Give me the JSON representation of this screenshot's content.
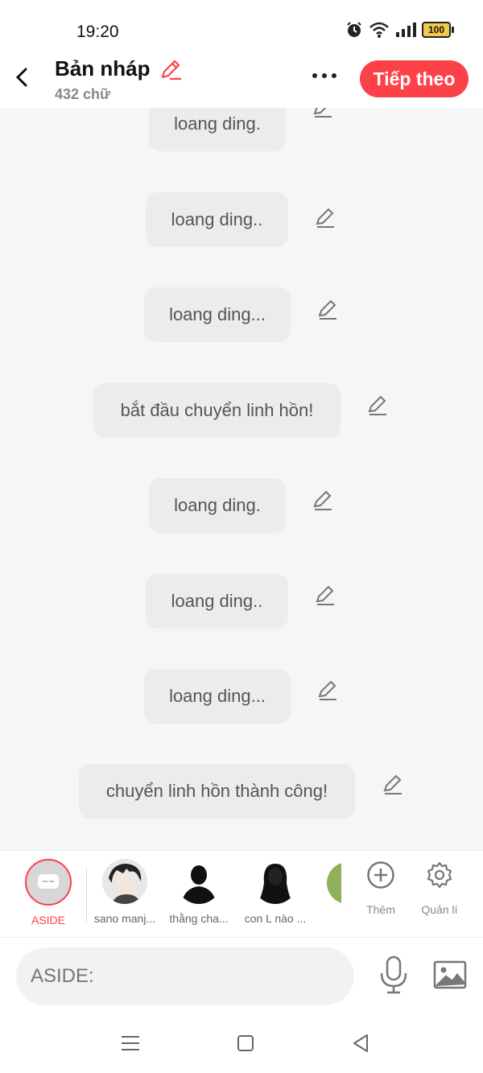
{
  "status_bar": {
    "time": "19:20",
    "battery": "100",
    "icons": [
      "alarm-icon",
      "wifi-icon",
      "signal-icon",
      "battery-icon"
    ]
  },
  "header": {
    "title": "Bản nháp",
    "subtitle": "432 chữ",
    "next_label": "Tiếp theo",
    "accent": "#fd4148"
  },
  "messages": [
    {
      "text": "loang ding."
    },
    {
      "text": "loang ding.."
    },
    {
      "text": "loang ding..."
    },
    {
      "text": "bắt đầu chuyển linh hồn!"
    },
    {
      "text": "loang ding."
    },
    {
      "text": "loang ding.."
    },
    {
      "text": "loang ding..."
    },
    {
      "text": "chuyển linh hồn thành công!"
    }
  ],
  "characters": [
    {
      "name": "ASIDE"
    },
    {
      "name": "sano manj..."
    },
    {
      "name": "thằng cha..."
    },
    {
      "name": "con L nào ..."
    }
  ],
  "tools": {
    "add_label": "Thêm",
    "manage_label": "Quản lí"
  },
  "input": {
    "placeholder": "ASIDE:"
  }
}
